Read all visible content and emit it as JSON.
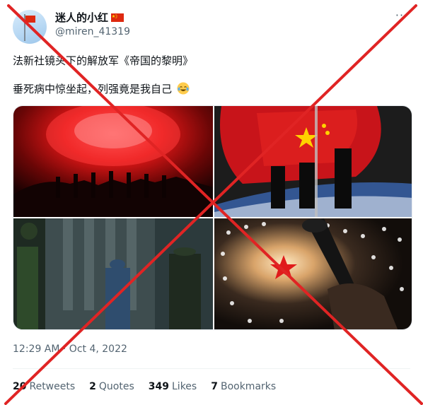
{
  "user": {
    "display_name": "迷人的小红",
    "handle": "@miren_41319",
    "flag_icon": "china-flag-icon"
  },
  "tweet": {
    "line1": "法新社镜头下的解放军《帝国的黎明》",
    "line2": "垂死病中惊坐起，列强竟是我自己",
    "emoji": "face-with-tears-of-joy-icon",
    "timestamp": "12:29 AM · Oct 4, 2022"
  },
  "stats": {
    "retweets_count": "20",
    "retweets_label": "Retweets",
    "quotes_count": "2",
    "quotes_label": "Quotes",
    "likes_count": "349",
    "likes_label": "Likes",
    "bookmarks_count": "7",
    "bookmarks_label": "Bookmarks"
  },
  "media": [
    {
      "icon": "fireworks-silhouettes-photo"
    },
    {
      "icon": "flag-guard-photo"
    },
    {
      "icon": "soldiers-building-photo"
    },
    {
      "icon": "bugle-star-ceiling-photo"
    }
  ],
  "colors": {
    "cross": "#e02424",
    "flag_red": "#de2910",
    "flag_yellow": "#ffde00",
    "muted_text": "#536471"
  }
}
